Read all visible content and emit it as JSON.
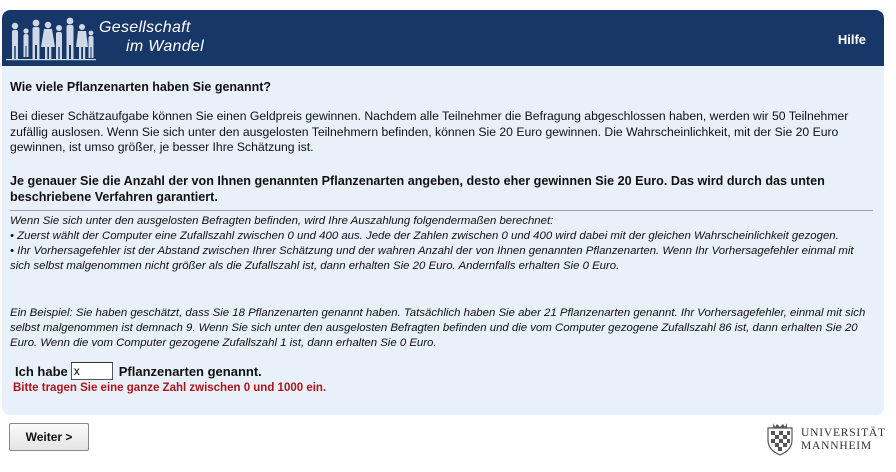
{
  "header": {
    "logo_line1": "Gesellschaft",
    "logo_line2": "im Wandel",
    "help_label": "Hilfe",
    "bg_color": "#163767"
  },
  "question": {
    "title": "Wie viele Pflanzenarten haben Sie genannt?",
    "intro": "Bei dieser Schätzaufgabe können Sie einen Geldpreis gewinnen. Nachdem alle Teilnehmer die Befragung abgeschlossen haben, werden wir 50 Teilnehmer zufällig auslosen. Wenn Sie sich unter den ausgelosten Teilnehmern befinden, können Sie 20 Euro gewinnen. Die Wahrscheinlichkeit, mit der Sie 20 Euro gewinnen, ist umso größer, je besser Ihre Schätzung ist.",
    "emphasis": "Je genauer Sie die Anzahl der von Ihnen genannten Pflanzenarten angeben, desto eher gewinnen Sie 20 Euro. Das wird durch das unten beschriebene Verfahren garantiert.",
    "rules_intro": "Wenn Sie sich unter den ausgelosten Befragten befinden, wird Ihre Auszahlung folgendermaßen berechnet:",
    "rule1": "• Zuerst wählt der Computer eine Zufallszahl zwischen 0 und 400 aus. Jede der Zahlen zwischen 0 und 400 wird dabei mit der gleichen Wahrscheinlichkeit gezogen.",
    "rule2": "• Ihr Vorhersagefehler ist der Abstand zwischen Ihrer Schätzung und der wahren Anzahl der von Ihnen genannten Pflanzenarten. Wenn Ihr Vorhersagefehler einmal mit sich selbst malgenommen nicht größer als die Zufallszahl ist, dann erhalten Sie 20 Euro. Andernfalls erhalten Sie 0 Euro.",
    "example": "Ein Beispiel: Sie haben geschätzt, dass Sie 18 Pflanzenarten genannt haben. Tatsächlich haben Sie aber 21 Pflanzenarten genannt. Ihr Vorhersagefehler, einmal mit sich selbst malgenommen ist demnach 9. Wenn Sie sich unter den ausgelosten Befragten befinden und die vom Computer gezogene Zufallszahl 86 ist, dann erhalten Sie 20 Euro. Wenn die vom Computer gezogene Zufallszahl 1 ist, dann erhalten Sie 0 Euro."
  },
  "answer": {
    "prefix": "Ich habe",
    "value": "x",
    "suffix": "Pflanzenarten genannt.",
    "error": "Bitte tragen Sie eine ganze Zahl zwischen 0 und 1000 ein.",
    "error_color": "#b0141a"
  },
  "footer": {
    "next_label": "Weiter >",
    "uni_line1": "UNIVERSITÄT",
    "uni_line2": "MANNHEIM"
  },
  "colors": {
    "panel_bg": "#e8f0fa",
    "accent": "#163767"
  }
}
